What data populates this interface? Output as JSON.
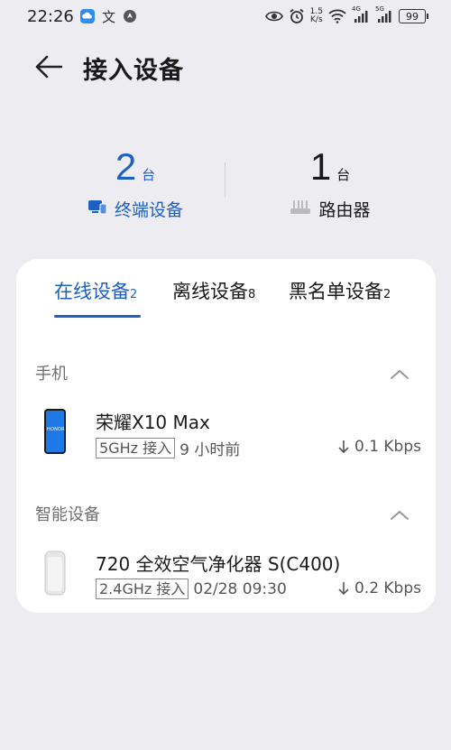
{
  "status_bar": {
    "time": "22:26",
    "net_speed_value": "1.5",
    "net_speed_unit": "K/s",
    "battery": "99",
    "signal1_label": "4G",
    "signal2_label": "5G"
  },
  "header": {
    "title": "接入设备"
  },
  "summary": {
    "terminal": {
      "count": "2",
      "unit": "台",
      "label": "终端设备"
    },
    "router": {
      "count": "1",
      "unit": "台",
      "label": "路由器"
    }
  },
  "tabs": [
    {
      "label": "在线设备",
      "count": "2"
    },
    {
      "label": "离线设备",
      "count": "8"
    },
    {
      "label": "黑名单设备",
      "count": "2"
    }
  ],
  "sections": [
    {
      "title": "手机",
      "devices": [
        {
          "name": "荣耀X10 Max",
          "band": "5GHz 接入",
          "time": "9 小时前",
          "speed": "0.1 Kbps",
          "brand_mark": "HONOR"
        }
      ]
    },
    {
      "title": "智能设备",
      "devices": [
        {
          "name": "720 全效空气净化器 S(C400)",
          "band": "2.4GHz 接入",
          "time": "02/28 09:30",
          "speed": "0.2 Kbps"
        }
      ]
    }
  ],
  "colors": {
    "accent": "#1e5fc2",
    "background": "#ececf1",
    "card": "#ffffff"
  }
}
